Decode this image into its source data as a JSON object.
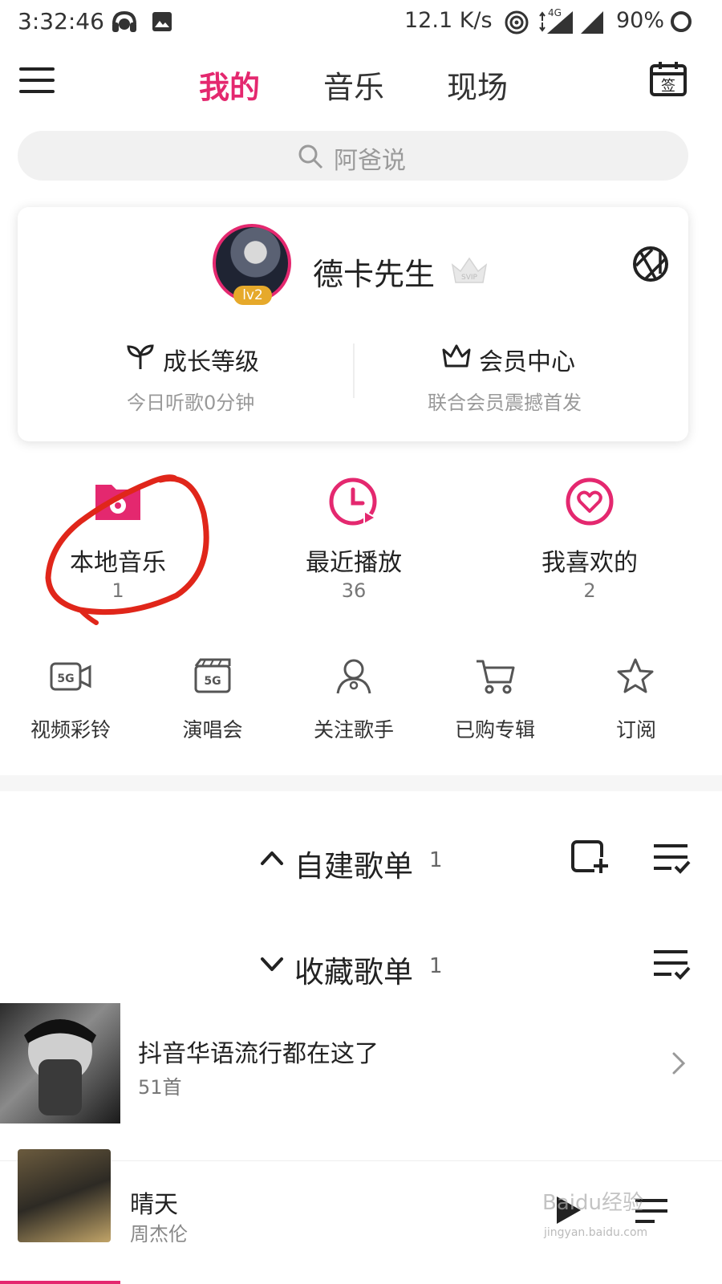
{
  "status_bar": {
    "time": "3:32:46",
    "net_speed": "12.1 K/s",
    "network": "4G",
    "battery": "90%"
  },
  "nav": {
    "tabs": [
      "我的",
      "音乐",
      "现场"
    ],
    "active": "我的"
  },
  "search": {
    "placeholder": "阿爸说"
  },
  "profile": {
    "name": "德卡先生",
    "level_badge": "lv2",
    "vip_badge": "SVIP",
    "growth": {
      "title": "成长等级",
      "subtitle": "今日听歌0分钟"
    },
    "member": {
      "title": "会员中心",
      "subtitle": "联合会员震撼首发"
    }
  },
  "quick_entries": [
    {
      "label": "本地音乐",
      "count": "1"
    },
    {
      "label": "最近播放",
      "count": "36"
    },
    {
      "label": "我喜欢的",
      "count": "2"
    }
  ],
  "small_entries": [
    {
      "label": "视频彩铃",
      "icon": "5g-video-icon"
    },
    {
      "label": "演唱会",
      "icon": "5g-clapper-icon"
    },
    {
      "label": "关注歌手",
      "icon": "singer-icon"
    },
    {
      "label": "已购专辑",
      "icon": "cart-icon"
    },
    {
      "label": "订阅",
      "icon": "star-icon"
    }
  ],
  "sections": {
    "created": {
      "title": "自建歌单",
      "count": "1"
    },
    "collected": {
      "title": "收藏歌单",
      "count": "1"
    }
  },
  "collected_playlists": [
    {
      "title": "抖音华语流行都在这了",
      "count": "51首"
    }
  ],
  "now_playing": {
    "title": "晴天",
    "artist": "周杰伦"
  },
  "watermark": {
    "text": "Baidu经验",
    "url": "jingyan.baidu.com"
  },
  "colors": {
    "accent": "#e4286f",
    "annotation": "#e0261a"
  }
}
